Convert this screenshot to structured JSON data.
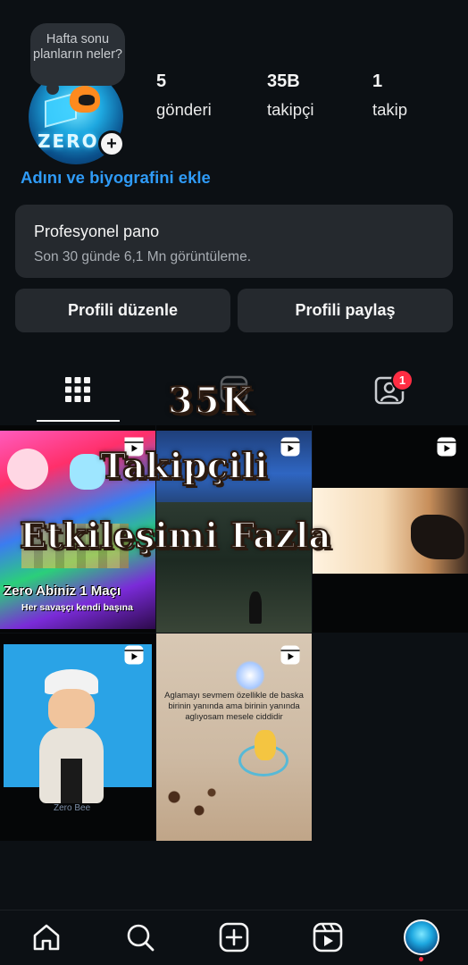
{
  "profile": {
    "note": "Hafta sonu planların neler?",
    "stats": [
      {
        "value": "5",
        "label": "gönderi"
      },
      {
        "value": "35B",
        "label": "takipçi"
      },
      {
        "value": "1",
        "label": "takip"
      }
    ],
    "bio_link": "Adını ve biyografini ekle"
  },
  "pro_panel": {
    "title": "Profesyonel pano",
    "subtitle": "Son 30 günde 6,1 Mn görüntüleme."
  },
  "buttons": {
    "edit": "Profili düzenle",
    "share": "Profili paylaş"
  },
  "tabs": {
    "tagged_badge": "1",
    "icons": [
      "grid-icon",
      "reels-icon",
      "tagged-icon"
    ]
  },
  "posts": {
    "t1_title": "Zero Abiniz 1 Maçı",
    "t1_sub": "Her savaşçı kendi başına",
    "t4_watermark": "Zero Bee",
    "t5_caption": "Aglamayı sevmem özellikle de baska birinin yanında ama birinin yanında aglıyosam mesele ciddidir"
  },
  "overlay": {
    "line1": "35K",
    "line2": "Takipçili",
    "line3": "Etkileşimi Fazla"
  },
  "nav": {
    "icons": [
      "home-icon",
      "search-icon",
      "create-icon",
      "reels-icon",
      "profile-avatar"
    ]
  },
  "colors": {
    "background": "#0c1014",
    "accent_link": "#2f9bf7",
    "panel": "#25292e",
    "badge": "#ff2d43"
  }
}
